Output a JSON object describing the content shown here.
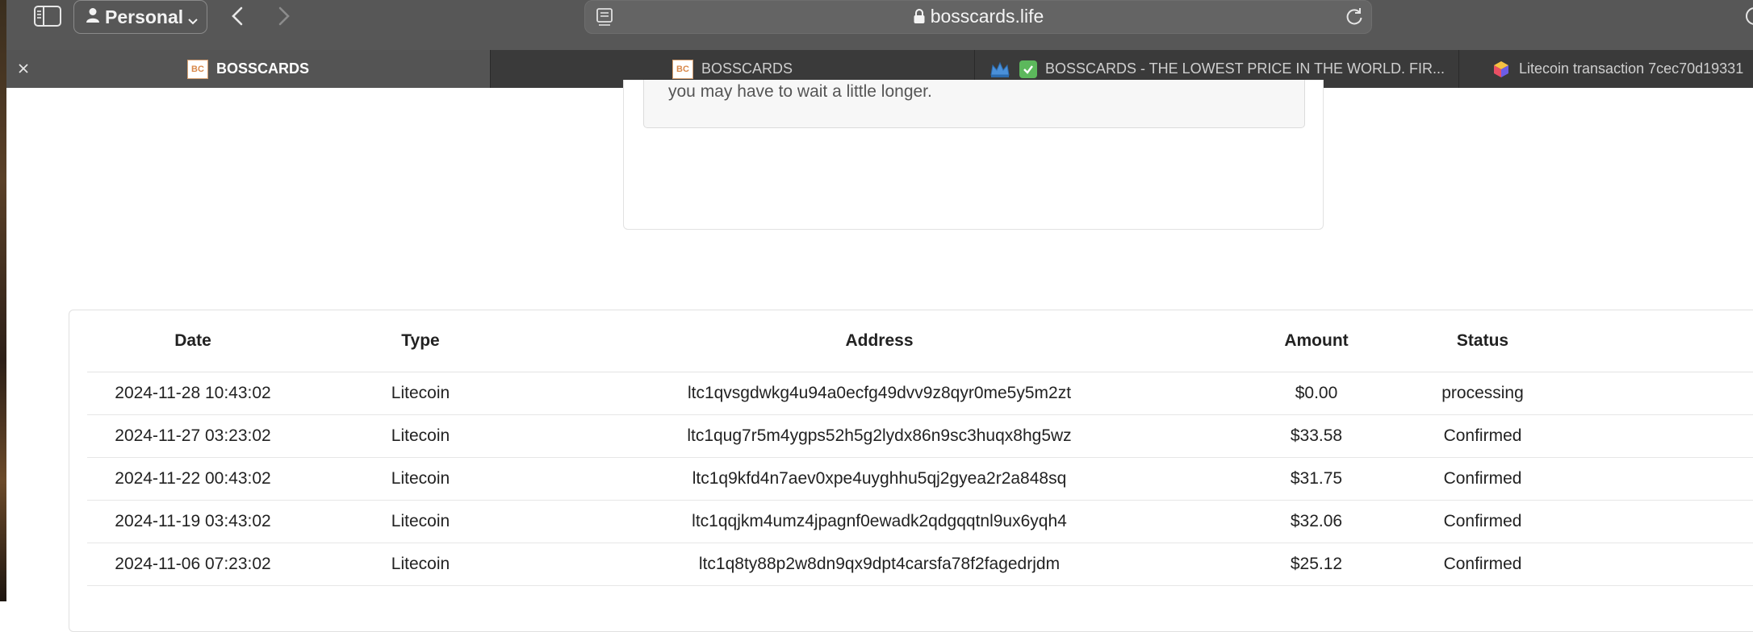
{
  "toolbar": {
    "profile_label": "Personal",
    "url": "bosscards.life"
  },
  "tabs": [
    {
      "label": "BOSSCARDS",
      "active": true
    },
    {
      "label": "BOSSCARDS",
      "active": false
    },
    {
      "label": "BOSSCARDS - THE LOWEST PRICE IN THE WORLD. FIR...",
      "active": false
    },
    {
      "label": "Litecoin transaction 7cec70d19331",
      "active": false
    }
  ],
  "notice": {
    "text": "you may have to wait a little longer."
  },
  "table": {
    "headers": {
      "date": "Date",
      "type": "Type",
      "address": "Address",
      "amount": "Amount",
      "status": "Status"
    },
    "rows": [
      {
        "date": "2024-11-28 10:43:02",
        "type": "Litecoin",
        "address": "ltc1qvsgdwkg4u94a0ecfg49dvv9z8qyr0me5y5m2zt",
        "amount": "$0.00",
        "status": "processing"
      },
      {
        "date": "2024-11-27 03:23:02",
        "type": "Litecoin",
        "address": "ltc1qug7r5m4ygps52h5g2lydx86n9sc3huqx8hg5wz",
        "amount": "$33.58",
        "status": "Confirmed"
      },
      {
        "date": "2024-11-22 00:43:02",
        "type": "Litecoin",
        "address": "ltc1q9kfd4n7aev0xpe4uyghhu5qj2gyea2r2a848sq",
        "amount": "$31.75",
        "status": "Confirmed"
      },
      {
        "date": "2024-11-19 03:43:02",
        "type": "Litecoin",
        "address": "ltc1qqjkm4umz4jpagnf0ewadk2qdgqqtnl9ux6yqh4",
        "amount": "$32.06",
        "status": "Confirmed"
      },
      {
        "date": "2024-11-06 07:23:02",
        "type": "Litecoin",
        "address": "ltc1q8ty88p2w8dn9qx9dpt4carsfa78f2fagedrjdm",
        "amount": "$25.12",
        "status": "Confirmed"
      }
    ]
  },
  "colors": {
    "toolbar_bg": "#575757",
    "tabbar_bg": "#3a3a3a",
    "active_tab_bg": "#545454",
    "favicon_accent": "#d8884a",
    "check_green": "#5cb85c"
  }
}
